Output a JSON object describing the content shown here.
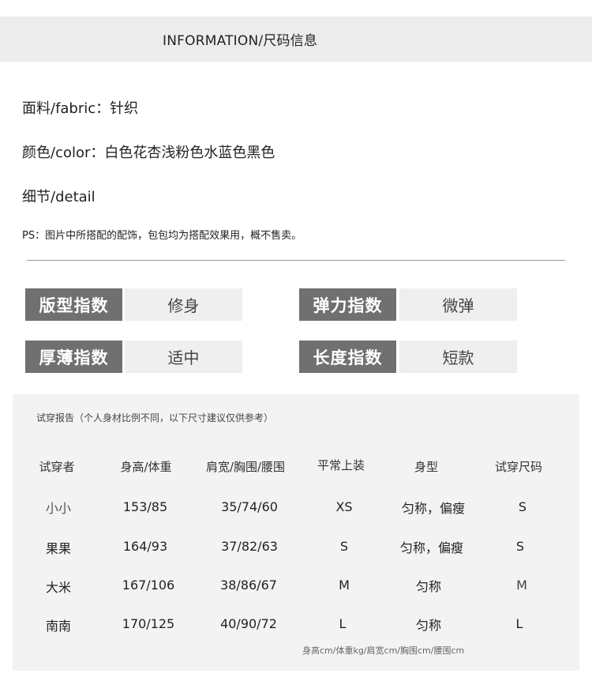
{
  "header": {
    "title": "INFORMATION/尺码信息"
  },
  "info": {
    "fabric": "面料/fabric：针织",
    "color": "颜色/color：白色花杏浅粉色水蓝色黑色",
    "detail": "细节/detail",
    "ps": "PS：图片中所搭配的配饰，包包均为搭配效果用，概不售卖。"
  },
  "metrics": [
    {
      "label": "版型指数",
      "value": "修身"
    },
    {
      "label": "弹力指数",
      "value": "微弹"
    },
    {
      "label": "厚薄指数",
      "value": "适中"
    },
    {
      "label": "长度指数",
      "value": "短款"
    }
  ],
  "table": {
    "note": "试穿报告（个人身材比例不同，以下尺寸建议仅供参考）",
    "headers": [
      "试穿者",
      "身高/体重",
      "肩宽/胸围/腰围",
      "平常上装",
      "身型",
      "试穿尺码"
    ],
    "rows": [
      [
        "小小",
        "153/85",
        "35/74/60",
        "XS",
        "匀称，偏瘦",
        "S"
      ],
      [
        "果果",
        "164/93",
        "37/82/63",
        "S",
        "匀称，偏瘦",
        "S"
      ],
      [
        "大米",
        "167/106",
        "38/86/67",
        "M",
        "匀称",
        "M"
      ],
      [
        "南南",
        "170/125",
        "40/90/72",
        "L",
        "匀称",
        "L"
      ]
    ],
    "footnote": "身高cm/体重kg/肩宽cm/胸围cm/腰围cm"
  }
}
